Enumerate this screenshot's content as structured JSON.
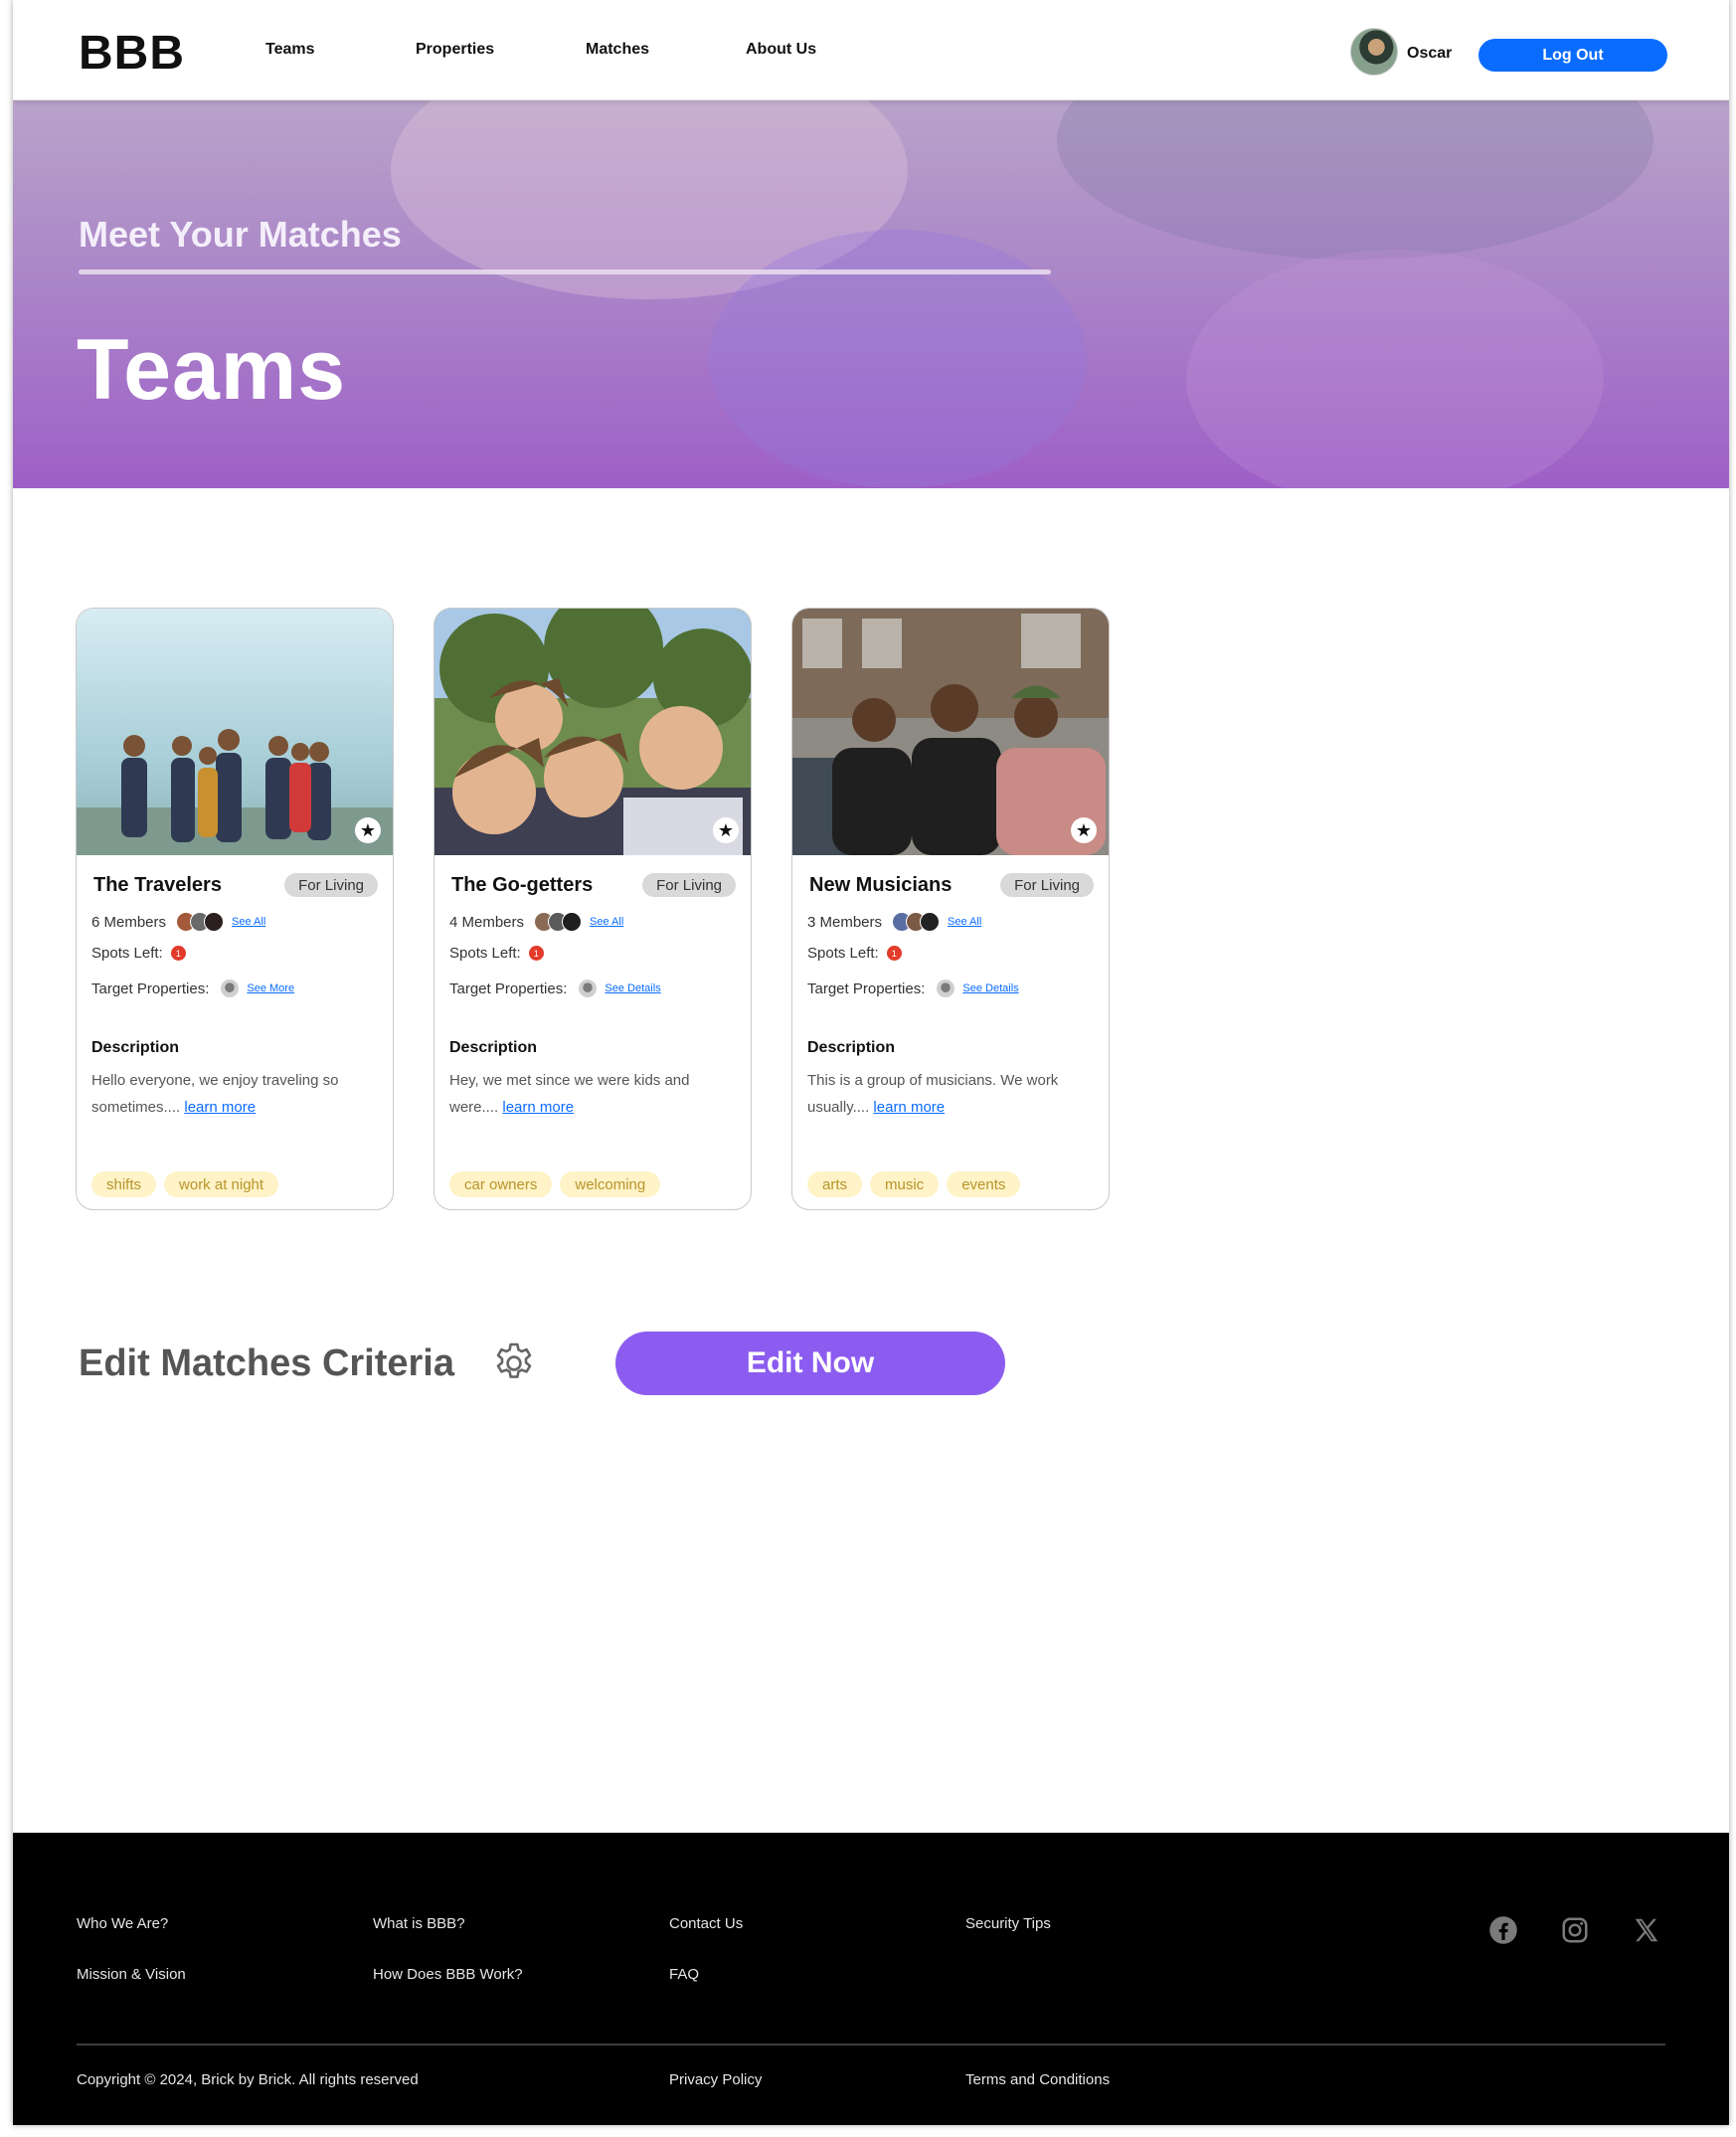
{
  "header": {
    "logo": "BBB",
    "nav": [
      "Teams",
      "Properties",
      "Matches",
      "About Us"
    ],
    "user_name": "Oscar",
    "logout_label": "Log Out"
  },
  "hero": {
    "eyebrow": "Meet Your Matches",
    "title": "Teams"
  },
  "cards": [
    {
      "title": "The Travelers",
      "type": "For Living",
      "members": "6 Members",
      "members_link": "See All",
      "spots_label": "Spots Left:",
      "spots_value": "1",
      "target_label": "Target Properties:",
      "target_link": "See More",
      "description_heading": "Description",
      "description_text": "Hello everyone, we enjoy traveling so sometimes....",
      "description_link": "learn more",
      "tags": [
        "shifts",
        "work at night"
      ]
    },
    {
      "title": "The Go-getters",
      "type": "For Living",
      "members": "4 Members",
      "members_link": "See All",
      "spots_label": "Spots Left:",
      "spots_value": "1",
      "target_label": "Target Properties:",
      "target_link": "See Details",
      "description_heading": "Description",
      "description_text": "Hey, we met since we were kids and were....",
      "description_link": "learn more",
      "tags": [
        "car owners",
        "welcoming"
      ]
    },
    {
      "title": "New Musicians",
      "type": "For Living",
      "members": "3 Members",
      "members_link": "See All",
      "spots_label": "Spots Left:",
      "spots_value": "1",
      "target_label": "Target Properties:",
      "target_link": "See Details",
      "description_heading": "Description",
      "description_text": "This is a group of musicians. We work usually....",
      "description_link": "learn more",
      "tags": [
        "arts",
        "music",
        "events"
      ]
    }
  ],
  "edit": {
    "title": "Edit Matches Criteria",
    "button_label": "Edit Now",
    "button_color": "#8c5cf0"
  },
  "footer": {
    "links": [
      "Who We Are?",
      "What is BBB?",
      "Contact Us",
      "Security Tips",
      "Mission & Vision",
      "How Does BBB Work?",
      "FAQ"
    ],
    "copyright": "Copyright © 2024, Brick by Brick. All rights reserved",
    "privacy": "Privacy Policy",
    "terms": "Terms and Conditions",
    "social_icons": [
      "facebook-icon",
      "instagram-icon",
      "x-icon"
    ]
  },
  "colors": {
    "accent_blue": "#0a6cff",
    "hero_purple": "#9e5fc7",
    "alert_red": "#e23b2a",
    "tag_bg": "#fff3c7"
  }
}
